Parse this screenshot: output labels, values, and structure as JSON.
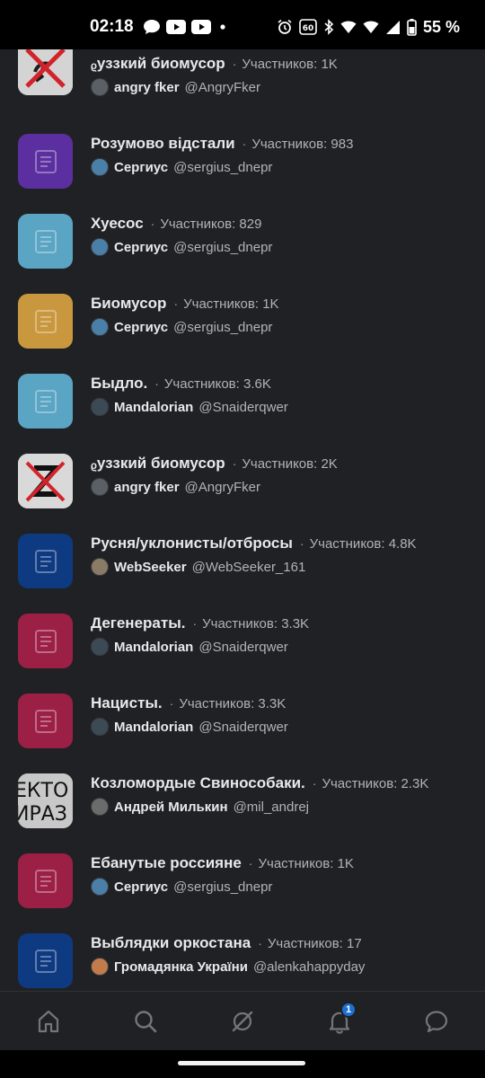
{
  "status_bar": {
    "time": "02:18",
    "battery_percent": "55 %",
    "left_icons": [
      "chat-bubble-icon",
      "youtube-icon",
      "youtube-icon",
      "dot-icon"
    ],
    "right_icons": [
      "alarm-icon",
      "refresh-rate-60-icon",
      "bluetooth-icon",
      "wifi-icon",
      "wifi-icon",
      "signal-icon",
      "battery-icon"
    ],
    "refresh_label": "60"
  },
  "lists": [
    {
      "name": "ᵨуззкий биомусор",
      "separator": "·",
      "members": "Участников: 1K",
      "owner_name": "angry fker",
      "owner_handle": "@AngryFker",
      "icon": "image-crossed-symbol",
      "avatar_color": "#5b5f66"
    },
    {
      "name": "Розумово відстали",
      "separator": "·",
      "members": "Участников: 983",
      "owner_name": "Сергиус",
      "owner_handle": "@sergius_dnepr",
      "icon": "list-icon",
      "icon_color": "#5b2fa0",
      "avatar_color": "#4a7fa8"
    },
    {
      "name": "Хуесос",
      "separator": "·",
      "members": "Участников: 829",
      "owner_name": "Сергиус",
      "owner_handle": "@sergius_dnepr",
      "icon": "list-icon",
      "icon_color": "#5aa4c4",
      "avatar_color": "#4a7fa8"
    },
    {
      "name": "Биомусор",
      "separator": "·",
      "members": "Участников: 1K",
      "owner_name": "Сергиус",
      "owner_handle": "@sergius_dnepr",
      "icon": "list-icon",
      "icon_color": "#c9973e",
      "avatar_color": "#4a7fa8"
    },
    {
      "name": "Быдло.",
      "separator": "·",
      "members": "Участников: 3.6K",
      "owner_name": "Mandalorian",
      "owner_handle": "@Snaiderqwer",
      "icon": "list-icon",
      "icon_color": "#5aa4c4",
      "avatar_color": "#3c4a55"
    },
    {
      "name": "ᵨуззкий биомусор",
      "separator": "·",
      "members": "Участников: 2K",
      "owner_name": "angry fker",
      "owner_handle": "@AngryFker",
      "icon": "image-crossed-z",
      "avatar_color": "#5b5f66"
    },
    {
      "name": "Русня/уклонисты/отбросы",
      "separator": "·",
      "members": "Участников: 4.8K",
      "owner_name": "WebSeeker",
      "owner_handle": "@WebSeeker_161",
      "icon": "list-icon",
      "icon_color": "#0e3a82",
      "avatar_color": "#8a7a66"
    },
    {
      "name": "Дегенераты.",
      "separator": "·",
      "members": "Участников: 3.3K",
      "owner_name": "Mandalorian",
      "owner_handle": "@Snaiderqwer",
      "icon": "list-icon",
      "icon_color": "#9c1f45",
      "avatar_color": "#3c4a55"
    },
    {
      "name": "Нацисты.",
      "separator": "·",
      "members": "Участников: 3.3K",
      "owner_name": "Mandalorian",
      "owner_handle": "@Snaiderqwer",
      "icon": "list-icon",
      "icon_color": "#9c1f45",
      "avatar_color": "#3c4a55"
    },
    {
      "name": "Козломордые Свинособаки.",
      "separator": "·",
      "members": "Участников: 2.3K",
      "owner_name": "Андрей Милькин",
      "owner_handle": "@mil_andrej",
      "icon": "image-text",
      "icon_text_lines": [
        "ЕКТО",
        "ИРАЗ"
      ],
      "avatar_color": "#6b6b6b"
    },
    {
      "name": "Ебанутые россияне",
      "separator": "·",
      "members": "Участников: 1K",
      "owner_name": "Сергиус",
      "owner_handle": "@sergius_dnepr",
      "icon": "list-icon",
      "icon_color": "#9c1f45",
      "avatar_color": "#4a7fa8"
    },
    {
      "name": "Выблядки оркостана",
      "separator": "·",
      "members": "Участников: 17",
      "owner_name": "Громадянка України",
      "owner_handle": "@alenkahappyday",
      "icon": "list-icon",
      "icon_color": "#0e3a82",
      "avatar_color": "#c27b4a"
    }
  ],
  "bottom_nav": {
    "items": [
      {
        "icon": "home-icon"
      },
      {
        "icon": "search-icon"
      },
      {
        "icon": "spaces-icon"
      },
      {
        "icon": "notifications-icon",
        "badge": "1"
      },
      {
        "icon": "messages-icon"
      }
    ]
  }
}
